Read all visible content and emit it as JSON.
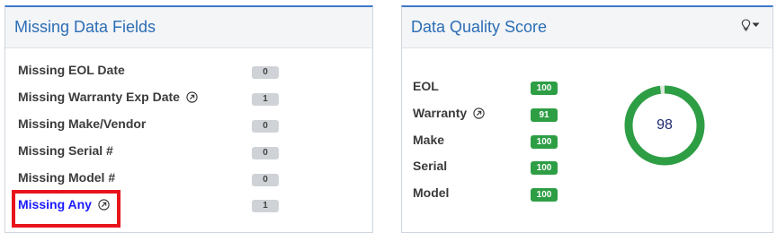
{
  "missing_panel": {
    "title": "Missing Data Fields",
    "rows": [
      {
        "label": "Missing EOL Date",
        "count": "0"
      },
      {
        "label": "Missing Warranty Exp Date",
        "count": "1"
      },
      {
        "label": "Missing Make/Vendor",
        "count": "0"
      },
      {
        "label": "Missing Serial #",
        "count": "0"
      },
      {
        "label": "Missing Model #",
        "count": "0"
      },
      {
        "label": "Missing Any",
        "count": "1"
      }
    ]
  },
  "quality_panel": {
    "title": "Data Quality Score",
    "rows": [
      {
        "label": "EOL",
        "score": "100"
      },
      {
        "label": "Warranty",
        "score": "91"
      },
      {
        "label": "Make",
        "score": "100"
      },
      {
        "label": "Serial",
        "score": "100"
      },
      {
        "label": "Model",
        "score": "100"
      }
    ],
    "overall_score": "98",
    "overall_fraction": 0.98
  },
  "colors": {
    "accent": "#3d78c8",
    "score_green": "#2e9e45",
    "gauge_track": "#dbe9dd",
    "highlight": "#e8141c",
    "link": "#1a1aff"
  },
  "icons": {
    "bulb": "lightbulb-icon",
    "chevron": "chevron-down-icon",
    "external": "external-link-icon"
  }
}
